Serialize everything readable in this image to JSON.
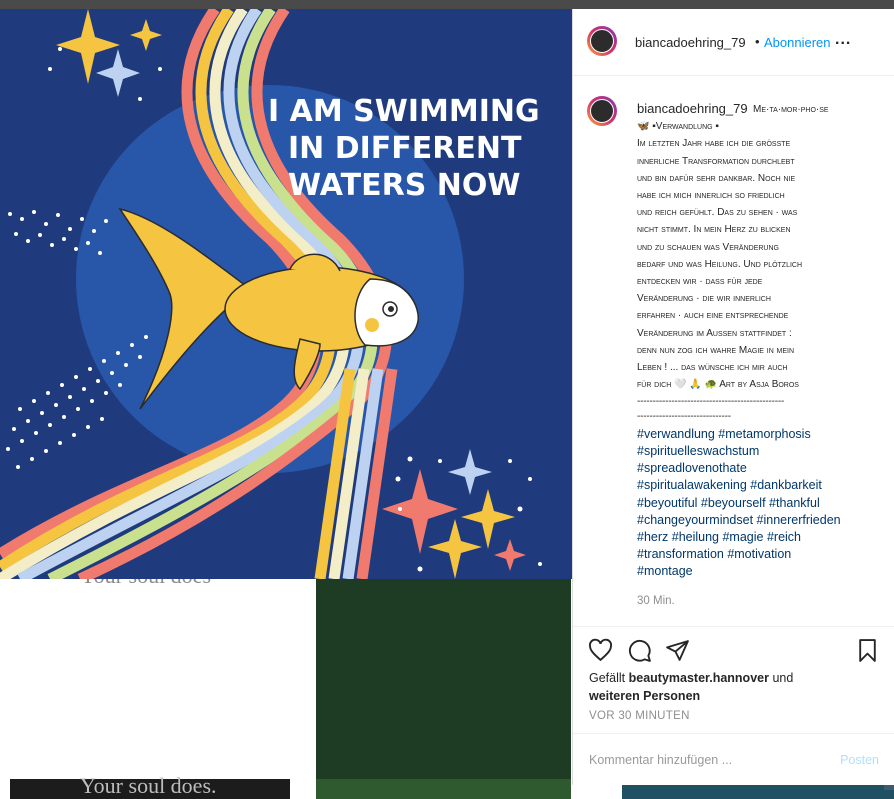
{
  "header": {
    "username": "biancadoehring_79",
    "dot": "•",
    "follow_label": "Abonnieren",
    "more_label": "..."
  },
  "image_text": {
    "line1": "I AM SWIMMING",
    "line2": "IN DIFFERENT",
    "line3": "WATERS NOW",
    "under_text_1": "Your soul does",
    "under_text_2": "Your soul does."
  },
  "caption": {
    "username": "biancadoehring_79",
    "lines": [
      "Me·ta·mor·pho·se",
      "🦋 ▪Verwandlung ▪",
      "Im letzten Jahr habe ich die größte",
      "innerliche Transformation durchlebt",
      "und bin dafür sehr dankbar. Noch nie",
      "habe ich mich innerlich so friedlich",
      "und reich gefühlt. Das zu sehen ·  was",
      "nicht stimmt. In mein Herz zu blicken",
      "und zu schauen was Veränderung",
      "bedarf und was Heilung. Und plötzlich",
      "entdecken wir ·  dass für jede",
      "Veränderung ·  die wir innerlich",
      "erfahren ·  auch eine entsprechende",
      "Veränderung im Außen stattfindet :",
      "denn nun zog ich wahre Magie in mein",
      "Leben !  ... das wünsche ich mir auch",
      "für dich 🤍 🙏 🐢 Art by Asja Boros"
    ],
    "divider_1": "-----------------------------------------------",
    "divider_2": "------------------------------",
    "hashtags": [
      "#verwandlung #metamorphosis",
      "#spirituelleswachstum",
      "#spreadlovenothate",
      "#spiritualawakening #dankbarkeit",
      "#beyoutiful #beyourself #thankful",
      "#changeyourmindset #innererfrieden",
      "#herz #heilung #magie #reich",
      "#transformation #motivation",
      "#montage"
    ],
    "time": "30 Min."
  },
  "actions": {
    "like_icon": "heart-icon",
    "comment_icon": "comment-icon",
    "share_icon": "paper-plane-icon",
    "save_icon": "bookmark-icon"
  },
  "likes": {
    "prefix": "Gefällt",
    "user": "beautymaster.hannover",
    "middle": "und",
    "others": "weiteren Personen"
  },
  "posted_ago": "VOR 30 MINUTEN",
  "comment": {
    "placeholder": "Kommentar hinzufügen ...",
    "post_label": "Posten"
  },
  "colors": {
    "link": "#0095f6",
    "hashtag": "#00376b",
    "image_bg": "#1f3a7d",
    "muted": "#8e8e8e"
  }
}
